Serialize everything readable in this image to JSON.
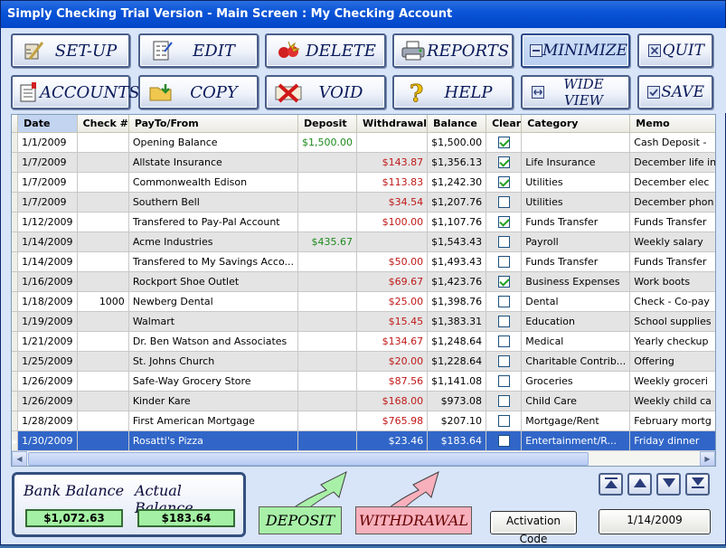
{
  "window": {
    "title": "Simply Checking Trial Version - Main Screen : My Checking Account"
  },
  "toolbar": {
    "setup": "SET-UP",
    "edit": "EDIT",
    "delete": "DELETE",
    "reports": "REPORTS",
    "minimize": "MINIMIZE",
    "quit": "QUIT",
    "accounts": "ACCOUNTS",
    "copy": "COPY",
    "void": "VOID",
    "help": "HELP",
    "wide_view": "WIDE VIEW",
    "save": "SAVE"
  },
  "grid": {
    "columns": [
      "Date",
      "Check #",
      "PayTo/From",
      "Deposit",
      "Withdrawal",
      "Balance",
      "Clear",
      "Category",
      "Memo"
    ],
    "rows": [
      {
        "date": "1/1/2009",
        "check": "",
        "payto": "Opening Balance",
        "deposit": "$1,500.00",
        "withdrawal": "",
        "balance": "$1,500.00",
        "clear": true,
        "category": "",
        "memo": "Cash Deposit - "
      },
      {
        "date": "1/7/2009",
        "check": "",
        "payto": "Allstate Insurance",
        "deposit": "",
        "withdrawal": "$143.87",
        "balance": "$1,356.13",
        "clear": true,
        "category": "Life Insurance",
        "memo": "December life ins"
      },
      {
        "date": "1/7/2009",
        "check": "",
        "payto": "Commonwealth Edison",
        "deposit": "",
        "withdrawal": "$113.83",
        "balance": "$1,242.30",
        "clear": true,
        "category": "Utilities",
        "memo": "December elec"
      },
      {
        "date": "1/7/2009",
        "check": "",
        "payto": "Southern Bell",
        "deposit": "",
        "withdrawal": "$34.54",
        "balance": "$1,207.76",
        "clear": false,
        "category": "Utilities",
        "memo": "December phon"
      },
      {
        "date": "1/12/2009",
        "check": "",
        "payto": "Transfered to Pay-Pal Account",
        "deposit": "",
        "withdrawal": "$100.00",
        "balance": "$1,107.76",
        "clear": true,
        "category": "Funds Transfer",
        "memo": "Funds Transfer"
      },
      {
        "date": "1/14/2009",
        "check": "",
        "payto": "Acme Industries",
        "deposit": "$435.67",
        "withdrawal": "",
        "balance": "$1,543.43",
        "clear": false,
        "category": "Payroll",
        "memo": "Weekly salary"
      },
      {
        "date": "1/14/2009",
        "check": "",
        "payto": "Transfered to My Savings Acco...",
        "deposit": "",
        "withdrawal": "$50.00",
        "balance": "$1,493.43",
        "clear": false,
        "category": "Funds Transfer",
        "memo": "Funds Transfer"
      },
      {
        "date": "1/16/2009",
        "check": "",
        "payto": "Rockport Shoe Outlet",
        "deposit": "",
        "withdrawal": "$69.67",
        "balance": "$1,423.76",
        "clear": true,
        "category": "Business Expenses",
        "memo": "Work boots"
      },
      {
        "date": "1/18/2009",
        "check": "1000",
        "payto": "Newberg Dental",
        "deposit": "",
        "withdrawal": "$25.00",
        "balance": "$1,398.76",
        "clear": false,
        "category": "Dental",
        "memo": "Check - Co-pay"
      },
      {
        "date": "1/19/2009",
        "check": "",
        "payto": "Walmart",
        "deposit": "",
        "withdrawal": "$15.45",
        "balance": "$1,383.31",
        "clear": false,
        "category": "Education",
        "memo": "School supplies"
      },
      {
        "date": "1/21/2009",
        "check": "",
        "payto": "Dr. Ben Watson and Associates",
        "deposit": "",
        "withdrawal": "$134.67",
        "balance": "$1,248.64",
        "clear": false,
        "category": "Medical",
        "memo": "Yearly checkup"
      },
      {
        "date": "1/25/2009",
        "check": "",
        "payto": "St. Johns Church",
        "deposit": "",
        "withdrawal": "$20.00",
        "balance": "$1,228.64",
        "clear": false,
        "category": "Charitable Contrib...",
        "memo": "Offering"
      },
      {
        "date": "1/26/2009",
        "check": "",
        "payto": "Safe-Way Grocery Store",
        "deposit": "",
        "withdrawal": "$87.56",
        "balance": "$1,141.08",
        "clear": false,
        "category": "Groceries",
        "memo": "Weekly groceri"
      },
      {
        "date": "1/26/2009",
        "check": "",
        "payto": "Kinder Kare",
        "deposit": "",
        "withdrawal": "$168.00",
        "balance": "$973.08",
        "clear": false,
        "category": "Child Care",
        "memo": "Weekly child ca"
      },
      {
        "date": "1/28/2009",
        "check": "",
        "payto": "First American Mortgage",
        "deposit": "",
        "withdrawal": "$765.98",
        "balance": "$207.10",
        "clear": false,
        "category": "Mortgage/Rent",
        "memo": "February mortg"
      },
      {
        "date": "1/30/2009",
        "check": "",
        "payto": "Rosatti's Pizza",
        "deposit": "",
        "withdrawal": "$23.46",
        "balance": "$183.64",
        "clear": false,
        "category": "Entertainment/R...",
        "memo": "Friday dinner"
      }
    ]
  },
  "balances": {
    "bank_label": "Bank Balance",
    "bank_value": "$1,072.63",
    "actual_label": "Actual Balance",
    "actual_value": "$183.64"
  },
  "actions": {
    "deposit": "DEPOSIT",
    "withdrawal": "WITHDRAWAL",
    "activation": "Activation Code",
    "date": "1/14/2009"
  }
}
